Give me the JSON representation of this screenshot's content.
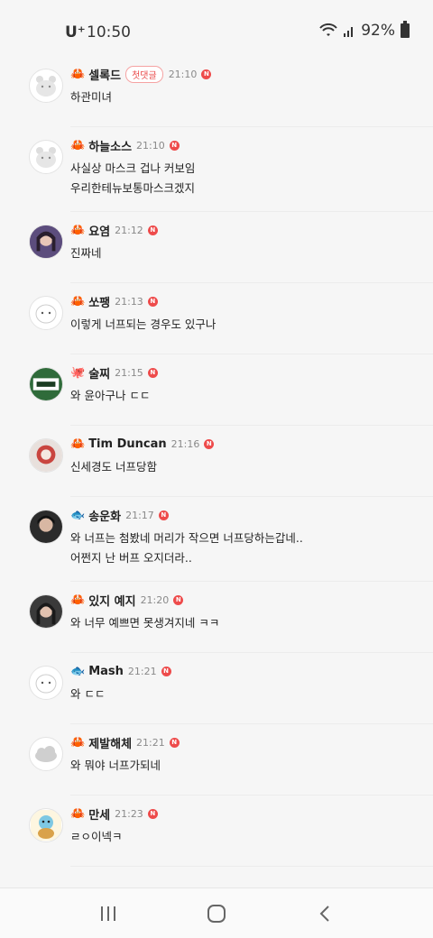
{
  "status_bar": {
    "carrier": "U⁺",
    "time": "10:50",
    "battery": "92%"
  },
  "comments": [
    {
      "level_icon": "🦀",
      "nick": "셀록드",
      "badge": "첫댓글",
      "time": "21:10",
      "new": "N",
      "lines": [
        "하관미녀"
      ]
    },
    {
      "level_icon": "🦀",
      "nick": "하늘소스",
      "time": "21:10",
      "new": "N",
      "lines": [
        "사실상 마스크 겁나 커보임",
        "우리한테뉴보통마스크겠지"
      ]
    },
    {
      "level_icon": "🦀",
      "nick": "요염",
      "time": "21:12",
      "new": "N",
      "lines": [
        "진짜네"
      ]
    },
    {
      "level_icon": "🦀",
      "nick": "쏘팽",
      "time": "21:13",
      "new": "N",
      "lines": [
        "이렇게 너프되는 경우도 있구나"
      ]
    },
    {
      "level_icon": "🐙",
      "nick": "술찌",
      "time": "21:15",
      "new": "N",
      "lines": [
        "와 윤아구나 ㄷㄷ"
      ]
    },
    {
      "level_icon": "🦀",
      "nick": "Tim Duncan",
      "time": "21:16",
      "new": "N",
      "lines": [
        "신세경도 너프당함"
      ]
    },
    {
      "level_icon": "🐟",
      "nick": "송운화",
      "time": "21:17",
      "new": "N",
      "lines": [
        "와 너프는 첨봤네 머리가 작으면 너프당하는갑네..",
        "어쩐지 난 버프 오지더라.."
      ]
    },
    {
      "level_icon": "🦀",
      "nick": "있지 예지",
      "time": "21:20",
      "new": "N",
      "lines": [
        "와 너무 예쁘면 못생겨지네 ㅋㅋ"
      ]
    },
    {
      "level_icon": "🐟",
      "nick": "Mash",
      "time": "21:21",
      "new": "N",
      "lines": [
        "와 ㄷㄷ"
      ]
    },
    {
      "level_icon": "🦀",
      "nick": "제발해체",
      "time": "21:21",
      "new": "N",
      "lines": [
        "와 뭐야 너프가되네"
      ]
    },
    {
      "level_icon": "🦀",
      "nick": "만세",
      "time": "21:23",
      "new": "N",
      "lines": [
        "ㄹㅇ이넥ㅋ"
      ]
    }
  ],
  "colors": {
    "new_badge": "#ee4b4b",
    "first_badge": "#e94a4a",
    "background": "#f6f6f6"
  }
}
